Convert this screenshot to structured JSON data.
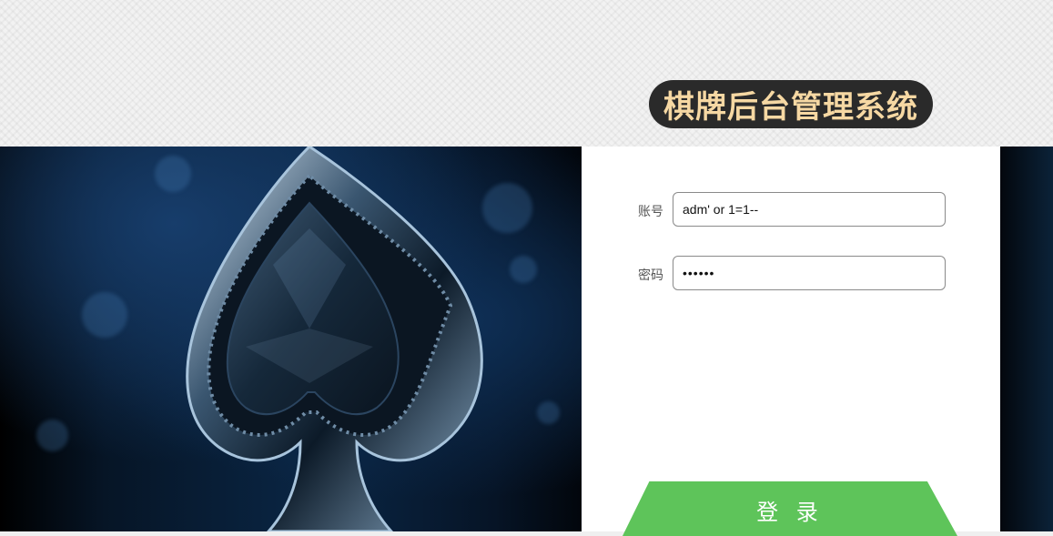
{
  "header": {
    "title": "棋牌后台管理系统"
  },
  "login_form": {
    "username_label": "账号",
    "username_value": "adm' or 1=1--",
    "password_label": "密码",
    "password_value": "••••••",
    "submit_label": "登 录"
  },
  "hero": {
    "icon": "spade-icon"
  },
  "colors": {
    "title_pill_bg": "#2a2a2a",
    "title_text": "#f6d8a3",
    "login_button": "#5ec45a",
    "hero_background": "#0a2645"
  }
}
